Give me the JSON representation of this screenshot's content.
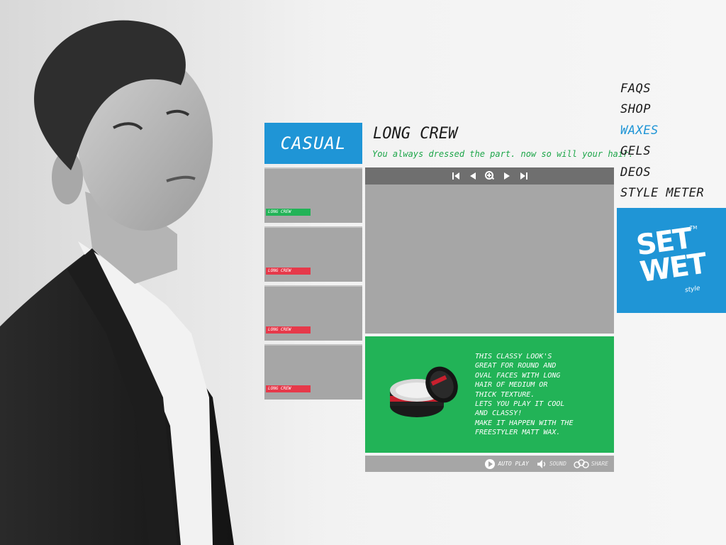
{
  "category": {
    "label": "CASUAL"
  },
  "style": {
    "title": "LONG CREW",
    "subtitle": "You always dressed the part. now so will your hair."
  },
  "thumbnails": [
    {
      "label": "LONG CREW",
      "tag_color": "#22b357"
    },
    {
      "label": "LONG CREW",
      "tag_color": "#e6394a"
    },
    {
      "label": "LONG CREW",
      "tag_color": "#e6394a"
    },
    {
      "label": "LONG CREW",
      "tag_color": "#e6394a"
    }
  ],
  "viewer": {
    "controls": [
      "first-icon",
      "previous-icon",
      "zoom-icon",
      "next-icon",
      "last-icon"
    ]
  },
  "product": {
    "lines": [
      "This classy look's",
      "great for round and",
      "oval faces with long",
      "hair of medium or",
      "thick texture.",
      "Lets you play it cool",
      "and classy!",
      "Make it happen with the",
      "freestyler matt wax."
    ]
  },
  "bottom_bar": {
    "autoplay": "AUTO PLAY",
    "sound": "SOUND",
    "share": "SHARE"
  },
  "nav": {
    "items": [
      "FAQS",
      "SHOP",
      "WAXES",
      "GELS",
      "DEOS",
      "STYLE METER"
    ],
    "active_index": 2
  },
  "logo": {
    "line1": "SET",
    "line2": "WET",
    "sub": "style",
    "tm": "TM"
  },
  "colors": {
    "accent_blue": "#1f95d6",
    "accent_green": "#22b357",
    "tag_red": "#e6394a"
  }
}
